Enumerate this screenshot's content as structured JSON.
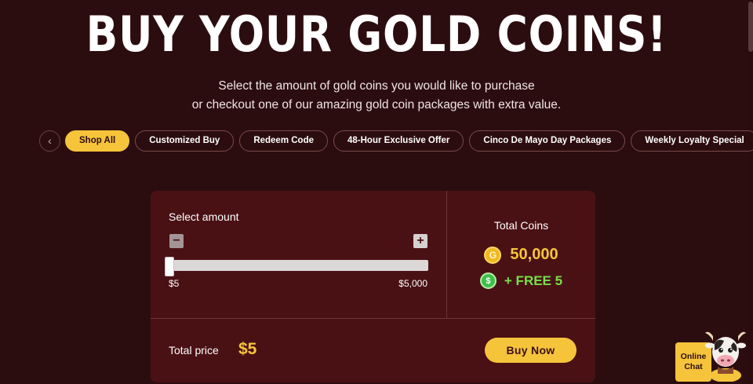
{
  "hero": {
    "title": "BUY YOUR GOLD COINS!",
    "subtitle_line1": "Select the amount of gold coins you would like to purchase",
    "subtitle_line2": "or checkout one of our amazing gold coin packages with extra value."
  },
  "tabs": [
    {
      "label": "Shop All",
      "active": true
    },
    {
      "label": "Customized Buy",
      "active": false
    },
    {
      "label": "Redeem Code",
      "active": false
    },
    {
      "label": "48-Hour Exclusive Offer",
      "active": false
    },
    {
      "label": "Cinco De Mayo Day Packages",
      "active": false
    },
    {
      "label": "Weekly Loyalty Special",
      "active": false
    }
  ],
  "nav": {
    "prev_icon": "chevron-left-icon",
    "next_icon": "chevron-right-icon"
  },
  "selector": {
    "label": "Select amount",
    "min_label": "$5",
    "max_label": "$5,000",
    "current_value": 5,
    "min": 5,
    "max": 5000,
    "minus_icon": "minus-icon",
    "plus_icon": "plus-icon"
  },
  "summary": {
    "title": "Total Coins",
    "coin_icon_glyph": "G",
    "coins": "50,000",
    "cash_icon_glyph": "$",
    "free": "+ FREE 5"
  },
  "checkout": {
    "price_label": "Total price",
    "price_value": "$5",
    "buy_label": "Buy Now"
  },
  "chat": {
    "line1": "Online",
    "line2": "Chat",
    "mascot_icon": "cow-mascot-icon"
  },
  "colors": {
    "background": "#2c0d0f",
    "card": "#4a1114",
    "accent": "#f6c43b",
    "free_green": "#77e04a"
  }
}
